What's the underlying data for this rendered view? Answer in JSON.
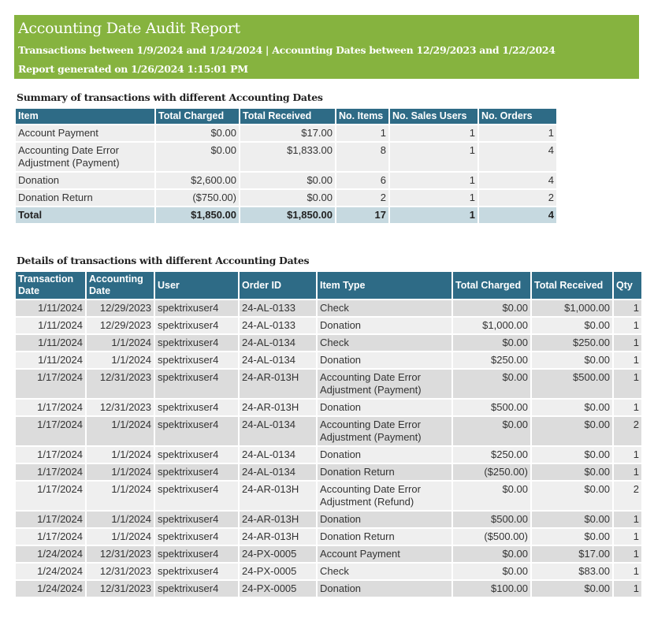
{
  "report": {
    "title": "Accounting Date Audit Report",
    "subtitle": "Transactions between 1/9/2024 and 1/24/2024 | Accounting Dates between 12/29/2023 and 1/22/2024",
    "generated": "Report generated on 1/26/2024 1:15:01 PM"
  },
  "summary": {
    "title": "Summary of transactions with different Accounting Dates",
    "headers": [
      "Item",
      "Total Charged",
      "Total Received",
      "No. Items",
      "No. Sales Users",
      "No. Orders"
    ],
    "rows": [
      [
        "Account Payment",
        "$0.00",
        "$17.00",
        "1",
        "1",
        "1"
      ],
      [
        "Accounting Date Error Adjustment (Payment)",
        "$0.00",
        "$1,833.00",
        "8",
        "1",
        "4"
      ],
      [
        "Donation",
        "$2,600.00",
        "$0.00",
        "6",
        "1",
        "4"
      ],
      [
        "Donation Return",
        "($750.00)",
        "$0.00",
        "2",
        "1",
        "2"
      ]
    ],
    "total": [
      "Total",
      "$1,850.00",
      "$1,850.00",
      "17",
      "1",
      "4"
    ]
  },
  "details": {
    "title": "Details of transactions with different Accounting Dates",
    "headers": [
      "Transaction Date",
      "Accounting Date",
      "User",
      "Order ID",
      "Item Type",
      "Total Charged",
      "Total Received",
      "Qty"
    ],
    "rows": [
      [
        "1/11/2024",
        "12/29/2023",
        "spektrixuser4",
        "24-AL-0133",
        "Check",
        "$0.00",
        "$1,000.00",
        "1"
      ],
      [
        "1/11/2024",
        "12/29/2023",
        "spektrixuser4",
        "24-AL-0133",
        "Donation",
        "$1,000.00",
        "$0.00",
        "1"
      ],
      [
        "1/11/2024",
        "1/1/2024",
        "spektrixuser4",
        "24-AL-0134",
        "Check",
        "$0.00",
        "$250.00",
        "1"
      ],
      [
        "1/11/2024",
        "1/1/2024",
        "spektrixuser4",
        "24-AL-0134",
        "Donation",
        "$250.00",
        "$0.00",
        "1"
      ],
      [
        "1/17/2024",
        "12/31/2023",
        "spektrixuser4",
        "24-AR-013H",
        "Accounting Date Error Adjustment (Payment)",
        "$0.00",
        "$500.00",
        "1"
      ],
      [
        "1/17/2024",
        "12/31/2023",
        "spektrixuser4",
        "24-AR-013H",
        "Donation",
        "$500.00",
        "$0.00",
        "1"
      ],
      [
        "1/17/2024",
        "1/1/2024",
        "spektrixuser4",
        "24-AL-0134",
        "Accounting Date Error Adjustment (Payment)",
        "$0.00",
        "$0.00",
        "2"
      ],
      [
        "1/17/2024",
        "1/1/2024",
        "spektrixuser4",
        "24-AL-0134",
        "Donation",
        "$250.00",
        "$0.00",
        "1"
      ],
      [
        "1/17/2024",
        "1/1/2024",
        "spektrixuser4",
        "24-AL-0134",
        "Donation Return",
        "($250.00)",
        "$0.00",
        "1"
      ],
      [
        "1/17/2024",
        "1/1/2024",
        "spektrixuser4",
        "24-AR-013H",
        "Accounting Date Error Adjustment (Refund)",
        "$0.00",
        "$0.00",
        "2"
      ],
      [
        "1/17/2024",
        "1/1/2024",
        "spektrixuser4",
        "24-AR-013H",
        "Donation",
        "$500.00",
        "$0.00",
        "1"
      ],
      [
        "1/17/2024",
        "1/1/2024",
        "spektrixuser4",
        "24-AR-013H",
        "Donation Return",
        "($500.00)",
        "$0.00",
        "1"
      ],
      [
        "1/24/2024",
        "12/31/2023",
        "spektrixuser4",
        "24-PX-0005",
        "Account Payment",
        "$0.00",
        "$17.00",
        "1"
      ],
      [
        "1/24/2024",
        "12/31/2023",
        "spektrixuser4",
        "24-PX-0005",
        "Check",
        "$0.00",
        "$83.00",
        "1"
      ],
      [
        "1/24/2024",
        "12/31/2023",
        "spektrixuser4",
        "24-PX-0005",
        "Donation",
        "$100.00",
        "$0.00",
        "1"
      ]
    ]
  }
}
